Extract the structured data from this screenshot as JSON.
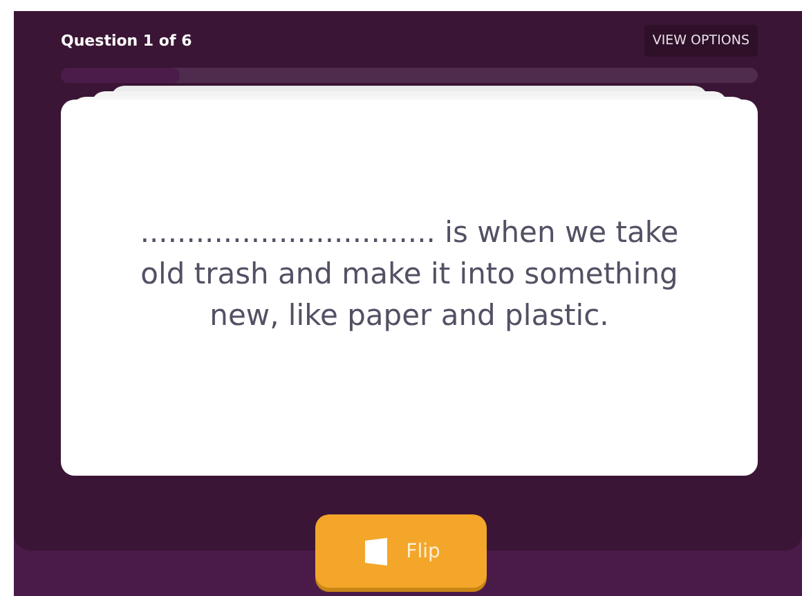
{
  "header": {
    "question_counter": "Question 1 of 6",
    "view_options": "VIEW OPTIONS"
  },
  "progress": {
    "level": 0.17
  },
  "card": {
    "text": "................................ is when we take old trash and make it into something new, like paper and plastic."
  },
  "flip_button": {
    "label": "Flip"
  }
}
